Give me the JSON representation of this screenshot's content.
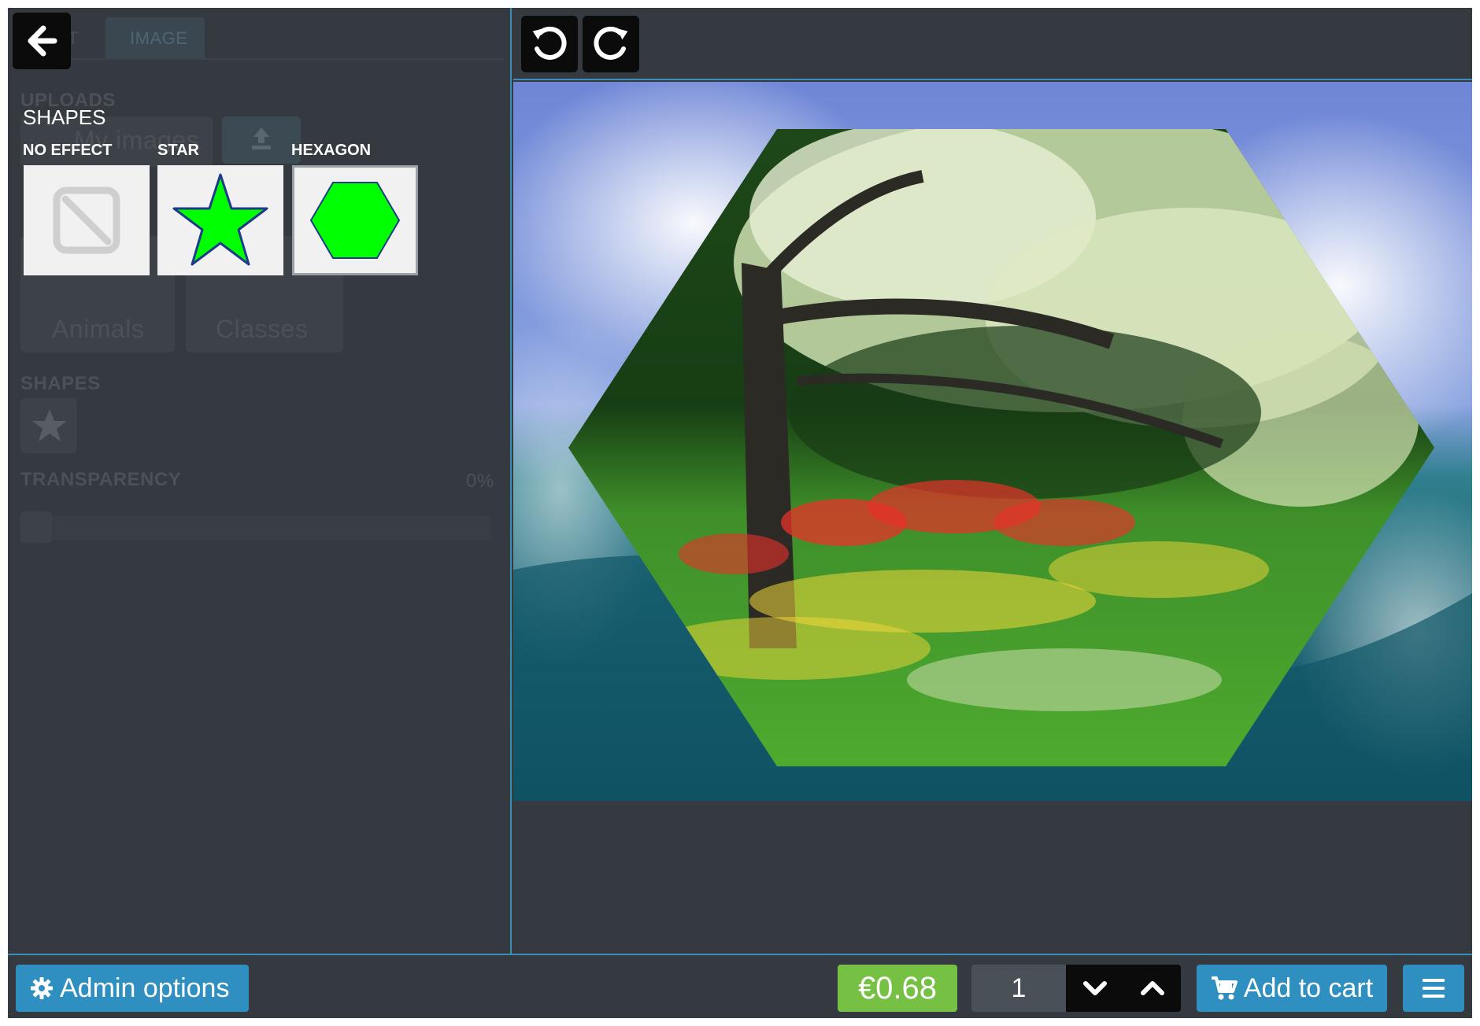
{
  "panel": {
    "tab_image": "IMAGE",
    "tab_text": "T",
    "uploads_label": "UPLOADS",
    "my_images_label": "My images",
    "animals_label": "Animals",
    "classes_label": "Classes",
    "shapes_label": "SHAPES",
    "transparency_label": "TRANSPARENCY",
    "transparency_value": "0%",
    "transparency_level": 0
  },
  "shapes_popup": {
    "title": "SHAPES",
    "options": [
      {
        "label": "NO EFFECT",
        "icon": "no-effect-icon",
        "selected": false
      },
      {
        "label": "STAR",
        "icon": "star-icon",
        "selected": false
      },
      {
        "label": "HEXAGON",
        "icon": "hexagon-icon",
        "selected": true
      }
    ]
  },
  "toolbar": {
    "back_icon": "arrow-left-icon",
    "undo_icon": "undo-icon",
    "redo_icon": "redo-icon"
  },
  "canvas": {
    "background": "ocean-wave-image",
    "clipped_image": "blossom-tree-meadow-image",
    "clip_shape": "hexagon"
  },
  "bottom": {
    "admin_label": "Admin options",
    "price": "€0.68",
    "quantity": "1",
    "add_to_cart_label": "Add to cart"
  },
  "colors": {
    "accent": "#2e8fc0",
    "price_green": "#76c043",
    "panel_bg": "#343a40",
    "shape_green": "#00ff00"
  }
}
